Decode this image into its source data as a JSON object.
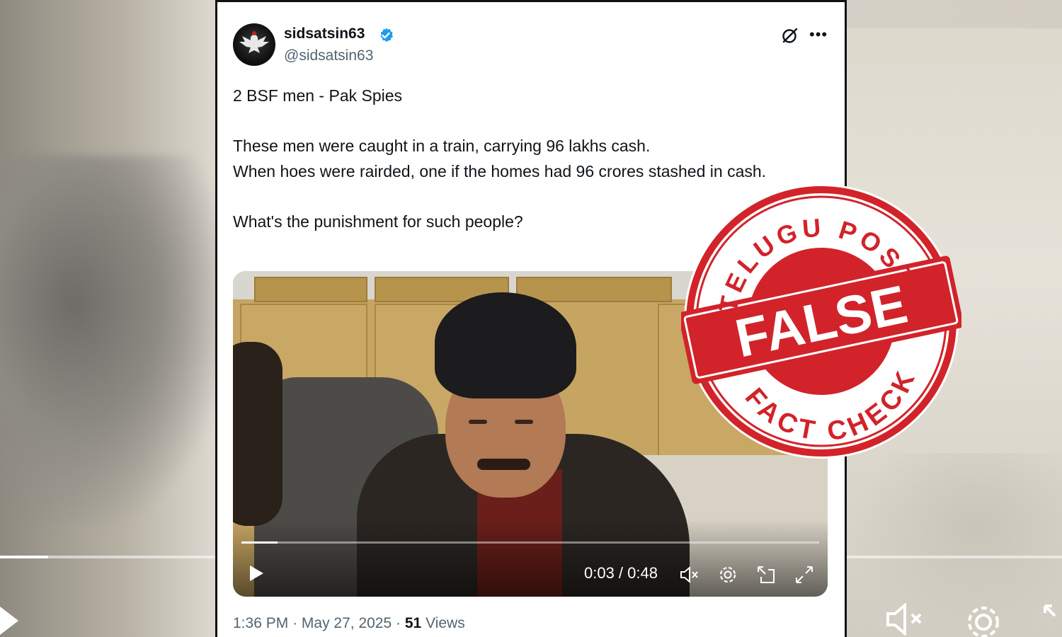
{
  "tweet": {
    "author_name": "sidsatsin63",
    "handle": "@sidsatsin63",
    "text": {
      "line1": "2 BSF men - Pak Spies",
      "line2": "These men were caught in a train, carrying 96 lakhs cash.",
      "line3": "When hoes were rairded, one if the homes had 96 crores stashed in cash.",
      "line4": "What's the punishment for such people?"
    },
    "video": {
      "current_time": "0:03",
      "duration": "0:48",
      "time_display": "0:03 / 0:48",
      "progress": 0.063
    },
    "time": "1:36 PM",
    "separator": "·",
    "date": "May 27, 2025",
    "views_count": "51",
    "views_label": "Views"
  },
  "stamp": {
    "top_text": "TELUGU POST",
    "center_text": "FALSE",
    "bottom_text": "FACT CHECK",
    "color": "#d2232a"
  },
  "colors": {
    "verified": "#1d9bf0",
    "primary_text": "#0f1419",
    "secondary_text": "#536471"
  },
  "icons": [
    "verified-badge-icon",
    "grok-icon",
    "more-options-icon",
    "play-icon",
    "mute-icon",
    "settings-icon",
    "pip-icon",
    "fullscreen-icon"
  ]
}
